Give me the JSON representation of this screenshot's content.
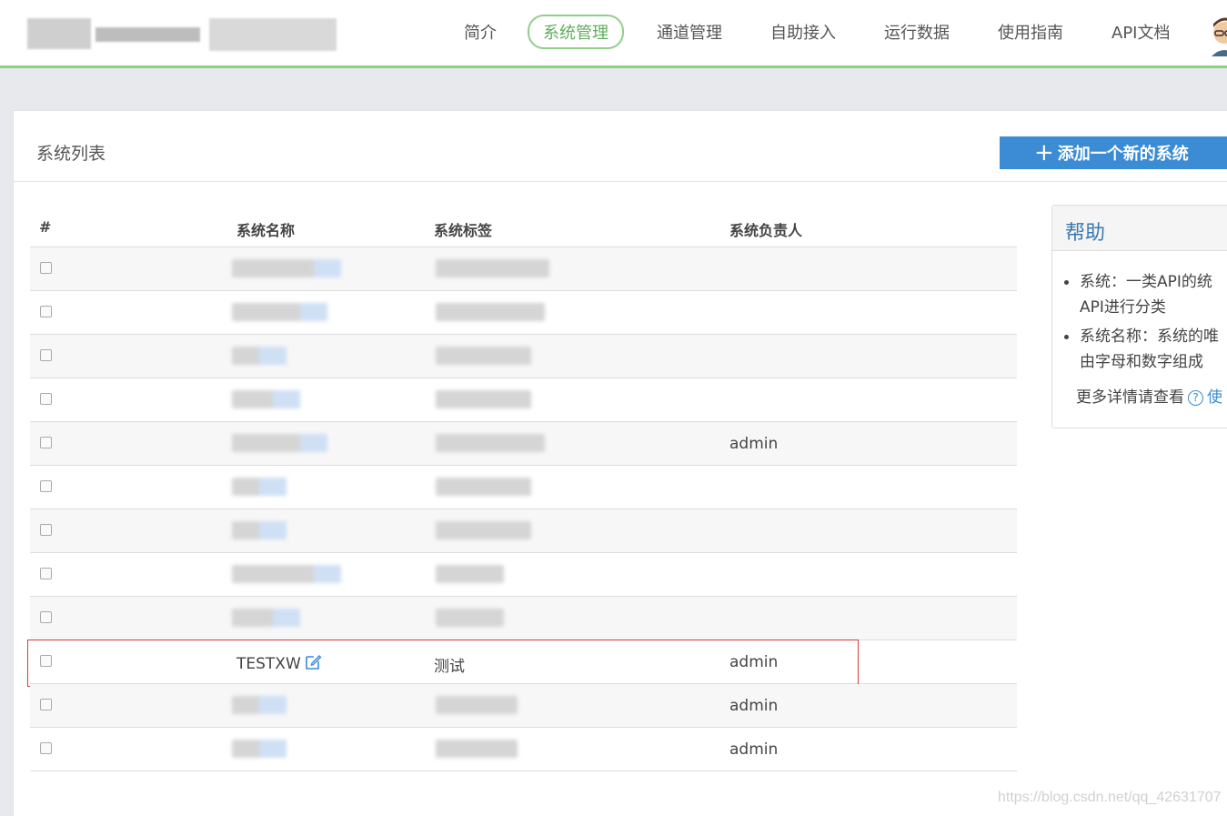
{
  "nav": {
    "items": [
      {
        "label": "简介"
      },
      {
        "label": "系统管理"
      },
      {
        "label": "通道管理"
      },
      {
        "label": "自助接入"
      },
      {
        "label": "运行数据"
      },
      {
        "label": "使用指南"
      },
      {
        "label": "API文档"
      }
    ],
    "active": "系统管理"
  },
  "panel": {
    "title": "系统列表",
    "add_button": "添加一个新的系统"
  },
  "table": {
    "columns": [
      "#",
      "系统名称",
      "系统标签",
      "系统负责人"
    ],
    "rows": [
      {
        "name": "",
        "tag": "",
        "owner": ""
      },
      {
        "name": "",
        "tag": "",
        "owner": ""
      },
      {
        "name": "",
        "tag": "",
        "owner": ""
      },
      {
        "name": "",
        "tag": "",
        "owner": ""
      },
      {
        "name": "",
        "tag": "",
        "owner": "admin"
      },
      {
        "name": "",
        "tag": "",
        "owner": ""
      },
      {
        "name": "",
        "tag": "",
        "owner": ""
      },
      {
        "name": "",
        "tag": "",
        "owner": ""
      },
      {
        "name": "",
        "tag": "",
        "owner": ""
      },
      {
        "name": "TESTXW",
        "tag": "测试",
        "owner": "admin"
      },
      {
        "name": "",
        "tag": "",
        "owner": "admin"
      },
      {
        "name": "",
        "tag": "",
        "owner": "admin"
      }
    ]
  },
  "help": {
    "title": "帮助",
    "items": [
      "系统：一类API的统",
      "API进行分类",
      "系统名称：系统的唯",
      "由字母和数字组成"
    ],
    "more_text": "更多详情请查看",
    "more_link": "使"
  },
  "watermark": "https://blog.csdn.net/qq_42631707",
  "colors": {
    "accent_green": "#8fcf8c",
    "primary_blue": "#3b8cd4",
    "highlight_red": "#d63b3b"
  }
}
